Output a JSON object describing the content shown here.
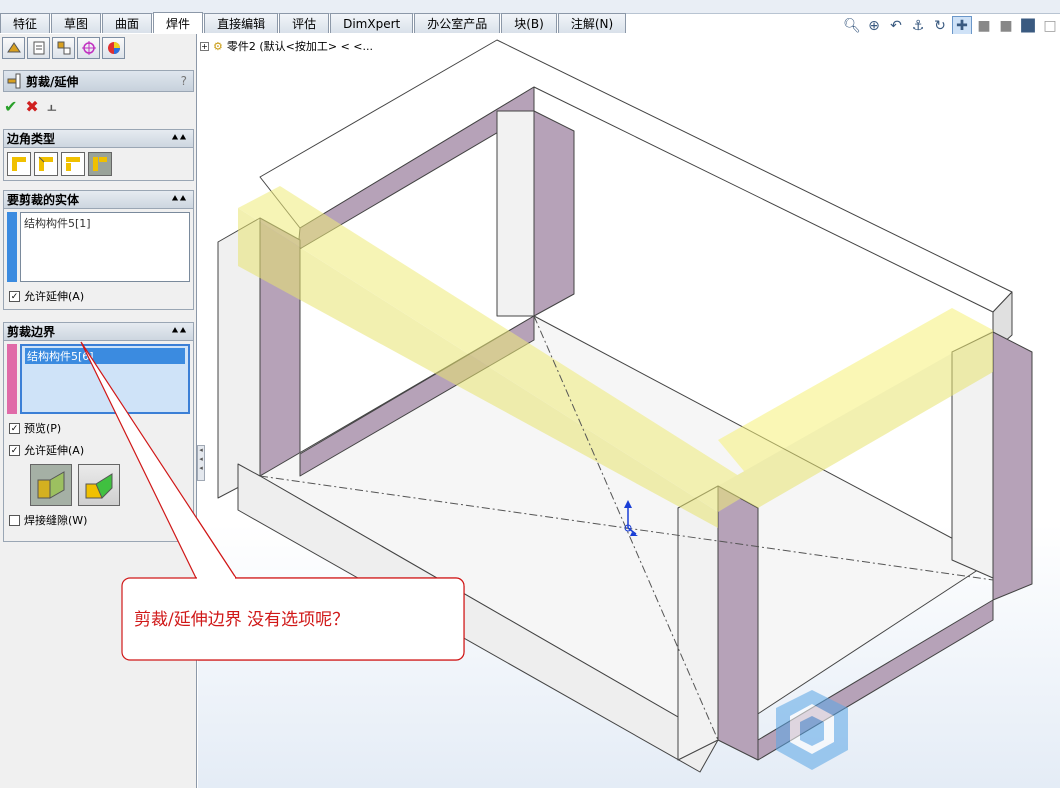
{
  "tabs": [
    {
      "label": "特征",
      "active": false
    },
    {
      "label": "草图",
      "active": false
    },
    {
      "label": "曲面",
      "active": false
    },
    {
      "label": "焊件",
      "active": true
    },
    {
      "label": "直接编辑",
      "active": false
    },
    {
      "label": "评估",
      "active": false
    },
    {
      "label": "DimXpert",
      "active": false
    },
    {
      "label": "办公室产品",
      "active": false
    },
    {
      "label": "块(B)",
      "active": false
    },
    {
      "label": "注解(N)",
      "active": false
    }
  ],
  "view_toolbar": {
    "icons": [
      "zoom-to-fit-icon",
      "zoom-to-area-icon",
      "previous-view-icon",
      "section-view-icon",
      "rotate-icon",
      "pan-icon",
      "display-style-icon",
      "hide-show-icon",
      "view-orientation-icon",
      "appearance-icon"
    ]
  },
  "feature_tree": {
    "part_label": "零件2 (默认<按加工> < <..."
  },
  "property_manager": {
    "title": "剪裁/延伸",
    "help": "?",
    "corner_type": {
      "heading": "边角类型",
      "selected_index": 3
    },
    "bodies_to_trim": {
      "heading": "要剪裁的实体",
      "items": [
        "结构构件5[1]"
      ],
      "allow_extend_label": "允许延伸(A)",
      "allow_extend_checked": true,
      "color": "#3b8be0"
    },
    "trim_boundary": {
      "heading": "剪裁边界",
      "items": [
        "结构构件5[6]"
      ],
      "preview_label": "预览(P)",
      "preview_checked": true,
      "allow_extend_label": "允许延伸(A)",
      "allow_extend_checked": true,
      "weld_gap_label": "焊接缝隙(W)",
      "weld_gap_checked": false,
      "color": "#e06aa8"
    }
  },
  "callout": {
    "text": "剪裁/延伸边界  没有选项呢？",
    "color": "#d01818"
  }
}
